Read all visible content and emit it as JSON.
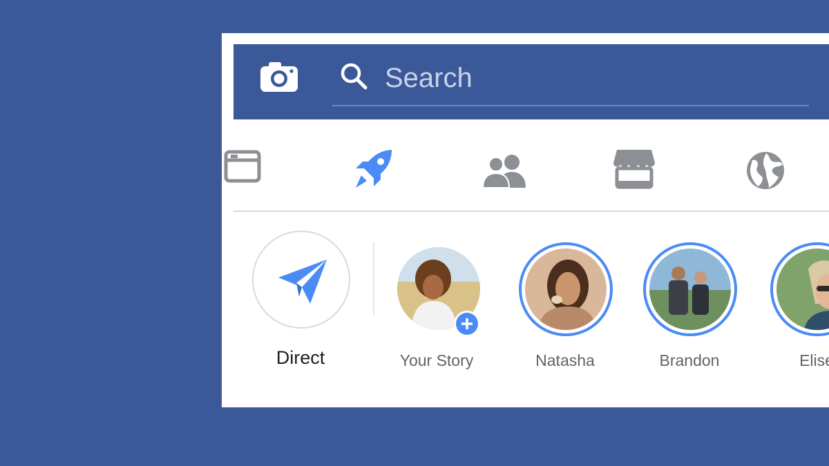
{
  "search": {
    "placeholder": "Search"
  },
  "tabs": [
    {
      "icon": "news-feed-icon"
    },
    {
      "icon": "rocket-icon",
      "active": true
    },
    {
      "icon": "friends-icon"
    },
    {
      "icon": "marketplace-icon"
    },
    {
      "icon": "globe-icon"
    }
  ],
  "stories": {
    "direct_label": "Direct",
    "items": [
      {
        "label": "Your Story"
      },
      {
        "label": "Natasha"
      },
      {
        "label": "Brandon"
      },
      {
        "label": "Elise"
      }
    ]
  },
  "colors": {
    "brand_blue": "#3b5998",
    "accent_blue": "#4a8bf5",
    "icon_gray": "#8c8f94",
    "story_ring": "#4a8bf5"
  }
}
